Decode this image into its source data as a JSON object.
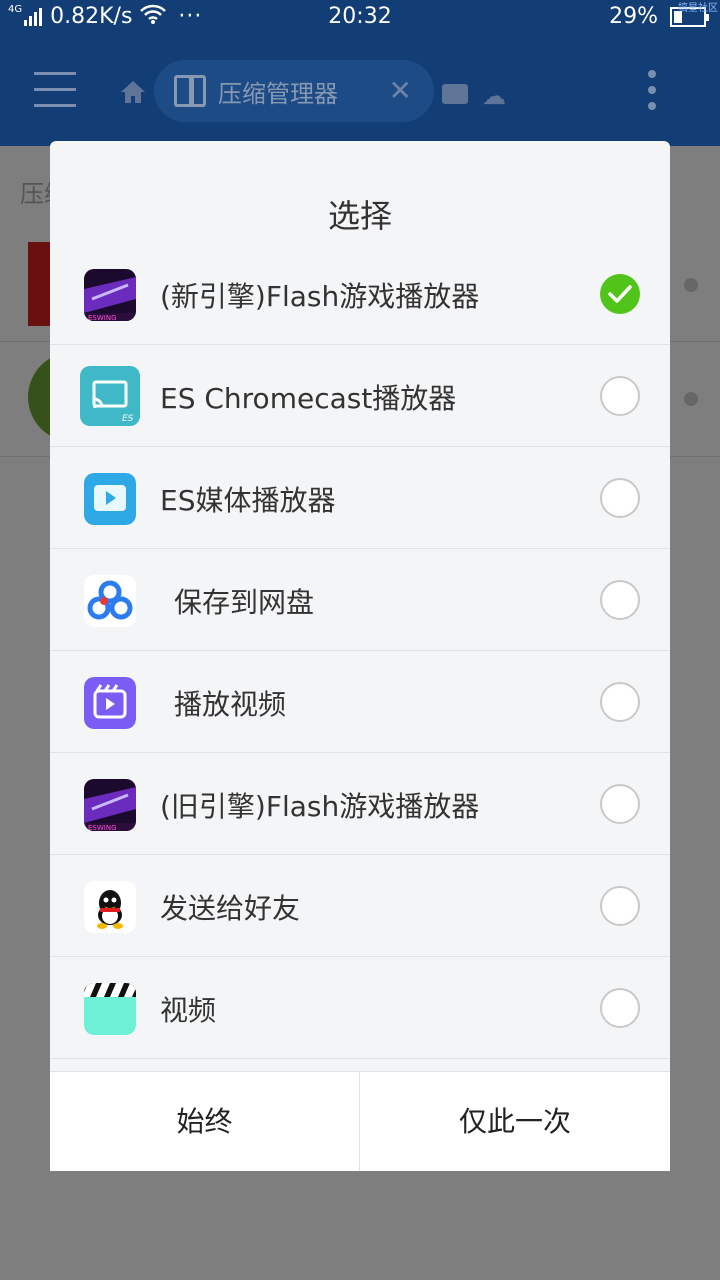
{
  "status_bar": {
    "network": "4G",
    "speed": "0.82K/s",
    "more": "···",
    "time": "20:32",
    "battery": "29%",
    "corner_text": "搞星社区"
  },
  "app_bar": {
    "tab_title": "压缩管理器"
  },
  "background": {
    "section_label": "压缩"
  },
  "dialog": {
    "title": "选择",
    "items": [
      {
        "label": "(新引擎)Flash游戏播放器",
        "icon": "flash-game-icon",
        "selected": true
      },
      {
        "label": "ES Chromecast播放器",
        "icon": "chromecast-icon",
        "selected": false
      },
      {
        "label": "ES媒体播放器",
        "icon": "es-media-player-icon",
        "selected": false
      },
      {
        "label": "保存到网盘",
        "icon": "baidu-netdisk-icon",
        "selected": false
      },
      {
        "label": "播放视频",
        "icon": "play-video-icon",
        "selected": false
      },
      {
        "label": "(旧引擎)Flash游戏播放器",
        "icon": "flash-game-icon",
        "selected": false
      },
      {
        "label": "发送给好友",
        "icon": "qq-icon",
        "selected": false
      },
      {
        "label": "视频",
        "icon": "video-clapper-icon",
        "selected": false
      }
    ],
    "always_button": "始终",
    "once_button": "仅此一次"
  },
  "colors": {
    "selected_radio": "#51c41a",
    "app_bar": "#123d75"
  }
}
